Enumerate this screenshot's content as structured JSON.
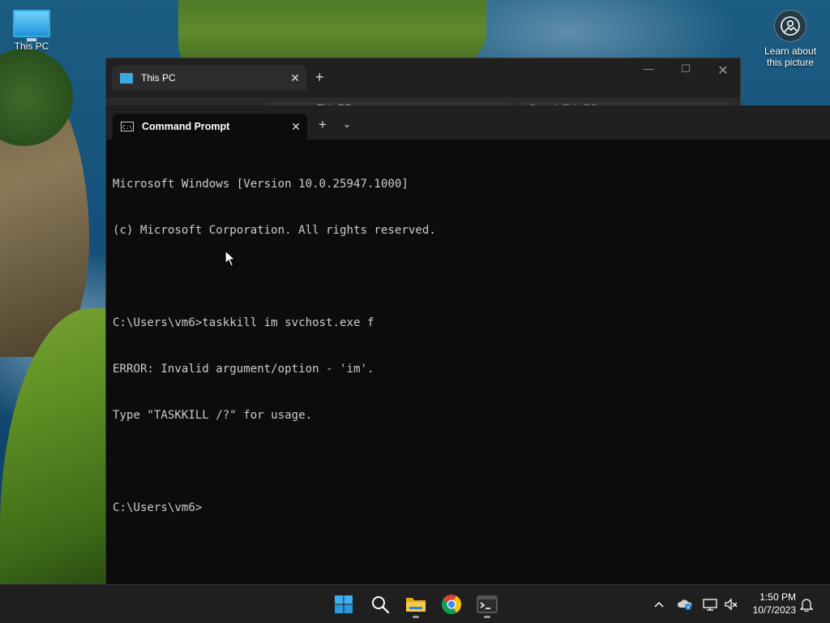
{
  "desktop": {
    "icons": [
      {
        "label": "This PC",
        "icon": "monitor-icon"
      },
      {
        "label": "Learn about this picture",
        "icon": "camera-circle-icon"
      }
    ]
  },
  "explorer": {
    "tab_title": "This PC",
    "tab_icon": "monitor-icon",
    "address_text": "This PC",
    "search_placeholder": "Search This PC"
  },
  "terminal": {
    "tab_title": "Command Prompt",
    "tab_icon": "cmd-icon",
    "lines": [
      "Microsoft Windows [Version 10.0.25947.1000]",
      "(c) Microsoft Corporation. All rights reserved.",
      "",
      "C:\\Users\\vm6>taskkill im svchost.exe f",
      "ERROR: Invalid argument/option - 'im'.",
      "Type \"TASKKILL /?\" for usage.",
      "",
      "C:\\Users\\vm6>"
    ]
  },
  "taskbar": {
    "apps": [
      "windows-start-icon",
      "search-icon",
      "file-explorer-icon",
      "chrome-icon",
      "terminal-icon"
    ],
    "clock": {
      "time": "1:50 PM",
      "date": "10/7/2023"
    }
  },
  "colors": {
    "terminal_bg": "#0c0c0c",
    "terminal_text": "#cccccc",
    "titlebar_bg": "#202020",
    "taskbar_bg": "#1f1f1f",
    "accent_blue": "#3aa9e0"
  }
}
